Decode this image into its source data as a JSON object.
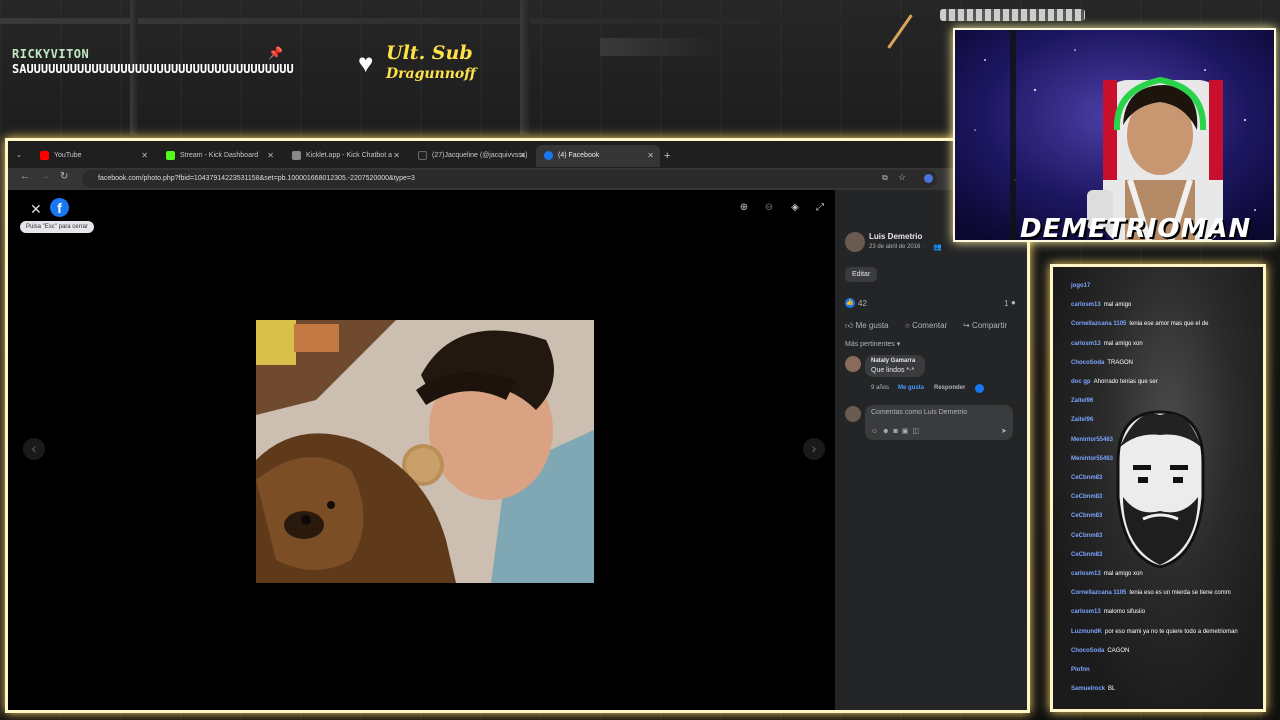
{
  "overlay": {
    "alert_user": "RICKYVITON",
    "alert_message": "SAUUUUUUUUUUUUUUUUUUUUUUUUUUUUUUUUUUUUU",
    "last_sub_title": "Ult. Sub",
    "last_sub_name": "Dragunnoff",
    "icons": [
      "pin-icon",
      "heart-icon"
    ]
  },
  "browser": {
    "tabs": [
      {
        "label": "YouTube",
        "icon_color": "#ff0000"
      },
      {
        "label": "Stream - Kick Dashboard",
        "icon_color": "#53fc18"
      },
      {
        "label": "Kicklet.app - Kick Chatbot a",
        "icon_color": "#888888"
      },
      {
        "label": "(27)Jacqueline (@jacquivvsss)",
        "icon_color": "#222222"
      },
      {
        "label": "(4) Facebook",
        "icon_color": "#1877f2",
        "active": true
      }
    ],
    "new_tab": "+",
    "url": "facebook.com/photo.php?fbid=10437914223531158&set=pb.100001668012305.-2207520000&type=3"
  },
  "viewer": {
    "tooltip": "Pulsa \"Esc\" para cerrar",
    "icons": [
      "zoom-in-icon",
      "zoom-out-icon",
      "tag-icon",
      "fullscreen-icon"
    ]
  },
  "post": {
    "author": "Luis Demetrio",
    "date": "23 de abril de 2016 ·",
    "edit_label": "Editar",
    "likes": "42",
    "comment_count": "1",
    "actions": {
      "like": "Me gusta",
      "comment": "Comentar",
      "share": "Compartir"
    },
    "sort_label": "Más pertinentes",
    "comment": {
      "author": "Nataly Gamarra",
      "text": "Que lindos *-*",
      "age": "9 años",
      "like": "Me gusta",
      "reply": "Responder"
    },
    "comment_placeholder": "Comentas como Luis Demetrio"
  },
  "webcam": {
    "name": "DEMETRIOMAN"
  },
  "chat": [
    {
      "user": "jogo17",
      "text": ""
    },
    {
      "user": "carlosm13",
      "text": "mal amigo"
    },
    {
      "user": "Cornellazcana 1105",
      "text": "tenia ese amor mas que el de"
    },
    {
      "user": "carlosm13",
      "text": "mal amigo xon"
    },
    {
      "user": "ChocoSoda",
      "text": "TRAGON"
    },
    {
      "user": "doc gp",
      "text": "Ahorrado tenias que ser"
    },
    {
      "user": "Zaitel96",
      "text": ""
    },
    {
      "user": "Zaitel96",
      "text": ""
    },
    {
      "user": "Menintor55463",
      "text": ""
    },
    {
      "user": "Menintor55463",
      "text": ""
    },
    {
      "user": "CeCbnm83",
      "text": ""
    },
    {
      "user": "CeCbnm83",
      "text": ""
    },
    {
      "user": "CeCbnm83",
      "text": ""
    },
    {
      "user": "CeCbnm83",
      "text": ""
    },
    {
      "user": "CeCbnm83",
      "text": ""
    },
    {
      "user": "carlosm13",
      "text": "mal amigo xon"
    },
    {
      "user": "Cornellazcana 1105",
      "text": "tenia eso es un mierda se tiene comm"
    },
    {
      "user": "carlosm13",
      "text": "malomo sifusiio"
    },
    {
      "user": "LuzmundK",
      "text": "por eso mami ya no te quiere todo a demetrioman"
    },
    {
      "user": "ChocoSoda",
      "text": "CAGON"
    },
    {
      "user": "Piofnn",
      "text": ""
    },
    {
      "user": "Samuelrock",
      "text": "BL"
    }
  ]
}
